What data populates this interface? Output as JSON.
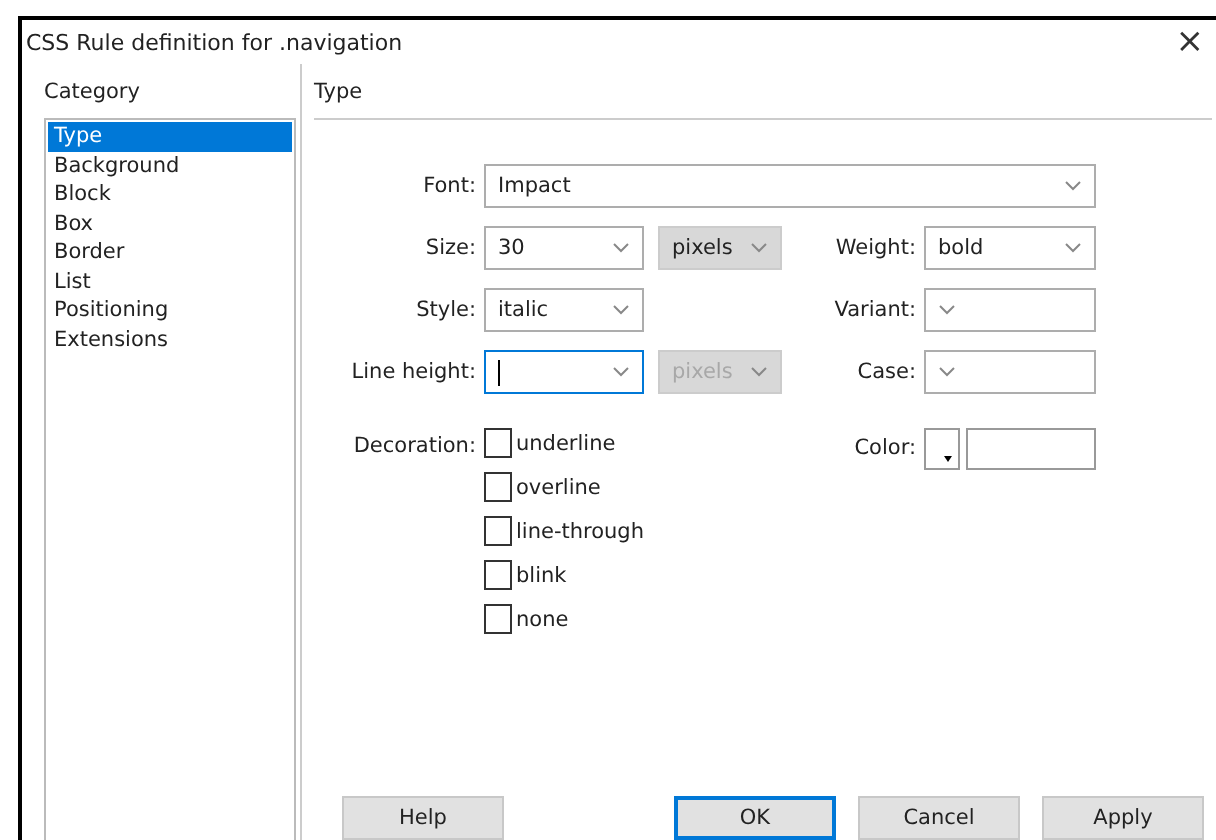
{
  "window": {
    "title": "CSS Rule definition for .navigation",
    "close": "×"
  },
  "category": {
    "label": "Category",
    "items": [
      {
        "label": "Type",
        "selected": true
      },
      {
        "label": "Background",
        "selected": false
      },
      {
        "label": "Block",
        "selected": false
      },
      {
        "label": "Box",
        "selected": false
      },
      {
        "label": "Border",
        "selected": false
      },
      {
        "label": "List",
        "selected": false
      },
      {
        "label": "Positioning",
        "selected": false
      },
      {
        "label": "Extensions",
        "selected": false
      }
    ]
  },
  "panel": {
    "title": "Type"
  },
  "font": {
    "label": "Font:",
    "value": "Impact"
  },
  "size": {
    "label": "Size:",
    "value": "30"
  },
  "size_unit": {
    "value": "pixels",
    "disabled": false
  },
  "weight": {
    "label": "Weight:",
    "value": "bold"
  },
  "style": {
    "label": "Style:",
    "value": "italic"
  },
  "variant": {
    "label": "Variant:"
  },
  "line_height": {
    "label": "Line height:",
    "focused": true
  },
  "line_height_unit": {
    "value": "pixels",
    "disabled": true
  },
  "case": {
    "label": "Case:"
  },
  "decoration": {
    "label": "Decoration:",
    "options": [
      {
        "label": "underline",
        "checked": false
      },
      {
        "label": "overline",
        "checked": false
      },
      {
        "label": "line-through",
        "checked": false
      },
      {
        "label": "blink",
        "checked": false
      },
      {
        "label": "none",
        "checked": false
      }
    ]
  },
  "color": {
    "label": "Color:"
  },
  "buttons": [
    {
      "label": "Help",
      "focused": false
    },
    {
      "label": "OK",
      "focused": true
    },
    {
      "label": "Cancel",
      "focused": false
    },
    {
      "label": "Apply",
      "focused": false
    }
  ]
}
